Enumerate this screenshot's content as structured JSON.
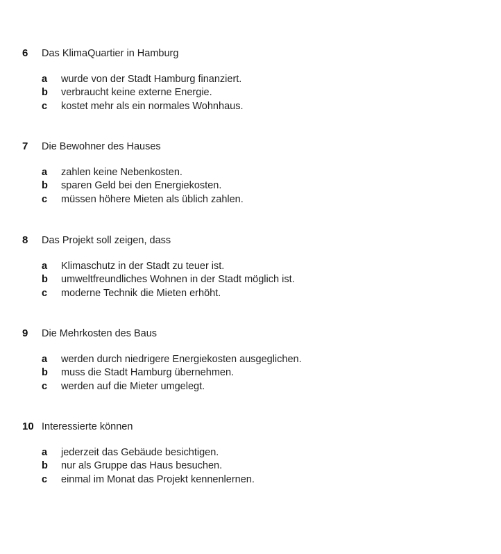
{
  "questions": [
    {
      "number": "6",
      "prompt": "Das KlimaQuartier in Hamburg",
      "options": [
        {
          "letter": "a",
          "text": "wurde von der Stadt Hamburg finanziert."
        },
        {
          "letter": "b",
          "text": "verbraucht keine externe Energie."
        },
        {
          "letter": "c",
          "text": "kostet mehr als ein normales Wohnhaus."
        }
      ]
    },
    {
      "number": "7",
      "prompt": "Die Bewohner des Hauses",
      "options": [
        {
          "letter": "a",
          "text": "zahlen keine Nebenkosten."
        },
        {
          "letter": "b",
          "text": "sparen Geld bei den Energiekosten."
        },
        {
          "letter": "c",
          "text": "müssen höhere Mieten als üblich zahlen."
        }
      ]
    },
    {
      "number": "8",
      "prompt": "Das Projekt soll zeigen, dass",
      "options": [
        {
          "letter": "a",
          "text": "Klimaschutz in der Stadt zu teuer ist."
        },
        {
          "letter": "b",
          "text": "umweltfreundliches Wohnen in der Stadt möglich ist."
        },
        {
          "letter": "c",
          "text": "moderne Technik die Mieten erhöht."
        }
      ]
    },
    {
      "number": "9",
      "prompt": "Die Mehrkosten des Baus",
      "options": [
        {
          "letter": "a",
          "text": "werden durch niedrigere Energiekosten ausgeglichen."
        },
        {
          "letter": "b",
          "text": "muss die Stadt Hamburg übernehmen."
        },
        {
          "letter": "c",
          "text": "werden auf die Mieter umgelegt."
        }
      ]
    },
    {
      "number": "10",
      "prompt": "Interessierte können",
      "options": [
        {
          "letter": "a",
          "text": "jederzeit das Gebäude besichtigen."
        },
        {
          "letter": "b",
          "text": "nur als Gruppe das Haus besuchen."
        },
        {
          "letter": "c",
          "text": "einmal im Monat das Projekt kennenlernen."
        }
      ]
    }
  ]
}
